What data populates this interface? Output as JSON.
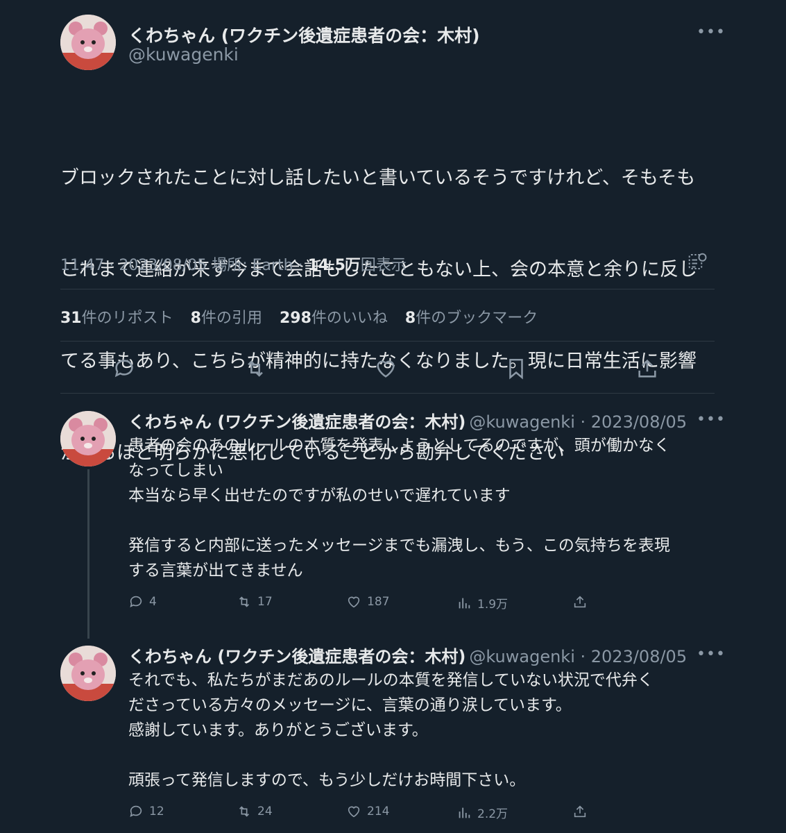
{
  "main_tweet": {
    "author_name": "くわちゃん (ワクチン後遺症患者の会：木村)",
    "handle": "@kuwagenki",
    "text_lines": [
      "ブロックされたことに対し話したいと書いているそうですけれど、そもそも",
      "これまで連絡が来ず今まで会話もしたこともない上、会の本意と余りに反し",
      "てる事もあり、こちらが精神的に持たなくなりました。現に日常生活に影響",
      "が出るほど明らかに悪化していることから勘弁してください"
    ],
    "time": "11:47",
    "date": "2023/08/05",
    "location_label": "場所: Earth",
    "views_count": "14.5万",
    "views_label": "回表示",
    "stats": [
      {
        "num": "31",
        "label": "件のリポスト"
      },
      {
        "num": "8",
        "label": "件の引用"
      },
      {
        "num": "298",
        "label": "件のいいね"
      },
      {
        "num": "8",
        "label": "件のブックマーク"
      }
    ]
  },
  "replies": [
    {
      "author_name": "くわちゃん (ワクチン後遺症患者の会：木村)",
      "handle": "@kuwagenki",
      "date": "2023/08/05",
      "text": "患者の会のあのルールの本質を発表しようとしてるのですが、頭が働かなく\nなってしまい\n本当なら早く出せたのですが私のせいで遅れています\n\n発信すると内部に送ったメッセージまでも漏洩し、もう、この気持ちを表現\nする言葉が出てきません",
      "replies": "4",
      "retweets": "17",
      "likes": "187",
      "views": "1.9万"
    },
    {
      "author_name": "くわちゃん (ワクチン後遺症患者の会：木村)",
      "handle": "@kuwagenki",
      "date": "2023/08/05",
      "text": "それでも、私たちがまだあのルールの本質を発信していない状況で代弁く\nださっている方々のメッセージに、言葉の通り涙しています。\n感謝しています。ありがとうございます。\n\n頑張って発信しますので、もう少しだけお時間下さい。",
      "replies": "12",
      "retweets": "24",
      "likes": "214",
      "views": "2.2万"
    }
  ],
  "colors": {
    "background": "#15202b",
    "text": "#e7e9ea",
    "muted": "#8b98a5",
    "divider": "#2f3a44"
  }
}
